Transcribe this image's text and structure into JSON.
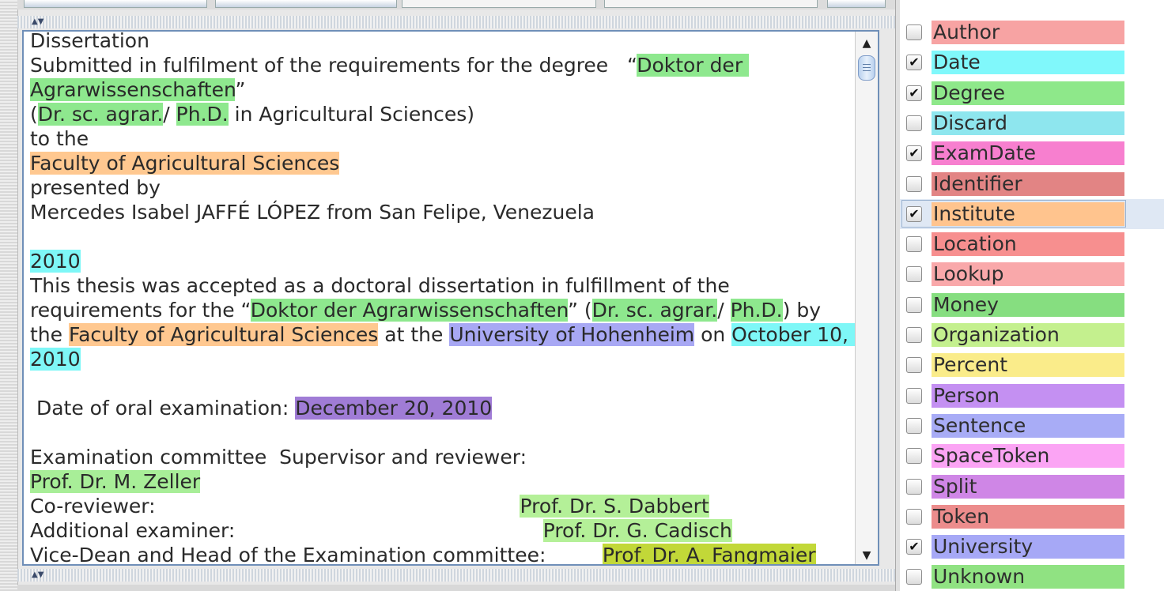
{
  "document": {
    "lines": [
      [
        {
          "t": "Dissertation"
        }
      ],
      [
        {
          "t": "Submitted in fulfilment of the requirements for the degree   “"
        },
        {
          "t": "Doktor der ",
          "h": "degree"
        }
      ],
      [
        {
          "t": "Agrarwissenschaften",
          "h": "degree"
        },
        {
          "t": "”"
        }
      ],
      [
        {
          "t": "("
        },
        {
          "t": "Dr. sc. agrar.",
          "h": "degree"
        },
        {
          "t": "/ "
        },
        {
          "t": "Ph.D.",
          "h": "degree"
        },
        {
          "t": " in Agricultural Sciences)"
        }
      ],
      [
        {
          "t": "to the"
        }
      ],
      [
        {
          "t": "Faculty of Agricultural Sciences",
          "h": "inst"
        }
      ],
      [
        {
          "t": "presented by"
        }
      ],
      [
        {
          "t": "Mercedes Isabel JAFFÉ LÓPEZ from San Felipe, Venezuela"
        }
      ],
      [],
      [
        {
          "t": "2010",
          "h": "date"
        }
      ],
      [
        {
          "t": "This thesis was accepted as a doctoral dissertation in fulfillment of the"
        }
      ],
      [
        {
          "t": "requirements for the “"
        },
        {
          "t": "Doktor der Agrarwissenschaften",
          "h": "degree"
        },
        {
          "t": "” ("
        },
        {
          "t": "Dr. sc. agrar.",
          "h": "degree"
        },
        {
          "t": "/ "
        },
        {
          "t": "Ph.D.",
          "h": "degree"
        },
        {
          "t": ") by"
        }
      ],
      [
        {
          "t": "the "
        },
        {
          "t": "Faculty of Agricultural Sciences",
          "h": "inst"
        },
        {
          "t": " at the "
        },
        {
          "t": "University of Hohenheim",
          "h": "univ"
        },
        {
          "t": " on "
        },
        {
          "t": "October 10, ",
          "h": "date"
        }
      ],
      [
        {
          "t": "2010",
          "h": "date"
        }
      ],
      [],
      [
        {
          "t": " Date of oral examination: "
        },
        {
          "t": "December 20, 2010",
          "h": "exam"
        }
      ],
      [],
      [
        {
          "t": "Examination committee  Supervisor and reviewer:"
        }
      ],
      [
        {
          "t": "Prof. Dr. M. Zeller",
          "h": "person1"
        }
      ],
      [
        {
          "t": "Co-reviewer:                                                          "
        },
        {
          "t": "Prof. Dr. S. Dabbert",
          "h": "person2"
        }
      ],
      [
        {
          "t": "Additional examiner:                                                 "
        },
        {
          "t": "Prof. Dr. G. Cadisch",
          "h": "person2"
        }
      ],
      [
        {
          "t": "Vice-Dean and Head of the Examination committee:         "
        },
        {
          "t": "Prof. Dr. A. Fangmaier",
          "h": "person3"
        }
      ]
    ]
  },
  "annotation_types": [
    {
      "label": "Author",
      "checked": false,
      "color": "#f7a3a3"
    },
    {
      "label": "Date",
      "checked": true,
      "color": "#80f8fb"
    },
    {
      "label": "Degree",
      "checked": true,
      "color": "#8ee88a"
    },
    {
      "label": "Discard",
      "checked": false,
      "color": "#8ee6ee"
    },
    {
      "label": "ExamDate",
      "checked": true,
      "color": "#f77fcf"
    },
    {
      "label": "Identifier",
      "checked": false,
      "color": "#e28484"
    },
    {
      "label": "Institute",
      "checked": true,
      "color": "#ffc48e",
      "selected": true
    },
    {
      "label": "Location",
      "checked": false,
      "color": "#f78f8f"
    },
    {
      "label": "Lookup",
      "checked": false,
      "color": "#f9a8aa"
    },
    {
      "label": "Money",
      "checked": false,
      "color": "#86de80"
    },
    {
      "label": "Organization",
      "checked": false,
      "color": "#c4f08e"
    },
    {
      "label": "Percent",
      "checked": false,
      "color": "#faec8a"
    },
    {
      "label": "Person",
      "checked": false,
      "color": "#c490f2"
    },
    {
      "label": "Sentence",
      "checked": false,
      "color": "#a8acf6"
    },
    {
      "label": "SpaceToken",
      "checked": false,
      "color": "#fba4f4"
    },
    {
      "label": "Split",
      "checked": false,
      "color": "#cf86e6"
    },
    {
      "label": "Token",
      "checked": false,
      "color": "#ec8c8c"
    },
    {
      "label": "University",
      "checked": true,
      "color": "#a6a8f6"
    },
    {
      "label": "Unknown",
      "checked": false,
      "color": "#90e282"
    }
  ],
  "icons": {
    "check_mark": "✔",
    "scroll_up": "▲",
    "scroll_down": "▼",
    "split_arrows": "▲▼"
  }
}
